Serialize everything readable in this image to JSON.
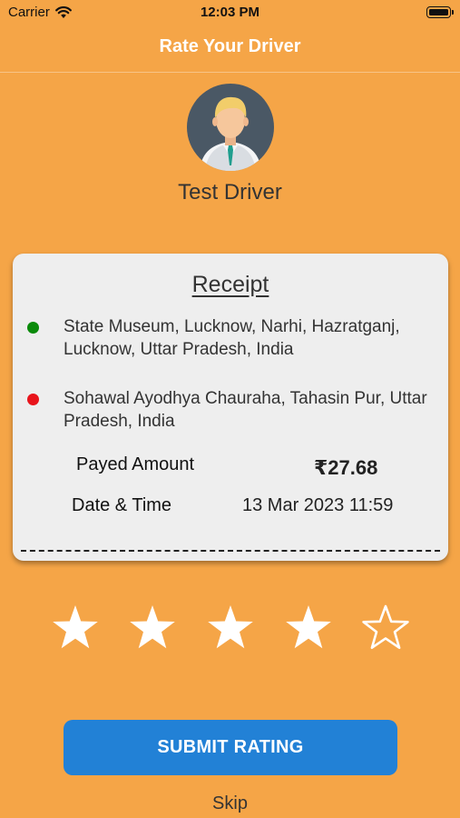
{
  "status_bar": {
    "carrier": "Carrier",
    "time": "12:03 PM",
    "wifi_icon": "wifi-icon",
    "battery_icon": "battery-full-icon"
  },
  "nav": {
    "title": "Rate Your Driver"
  },
  "driver": {
    "avatar_icon": "driver-avatar-icon",
    "name": "Test Driver"
  },
  "receipt": {
    "title": "Receipt",
    "pickup": {
      "address": "State Museum, Lucknow, Narhi, Hazratganj, Lucknow, Uttar Pradesh, India",
      "dot_color": "#0a8a0a"
    },
    "dropoff": {
      "address": "Sohawal Ayodhya Chauraha, Tahasin Pur, Uttar Pradesh, India",
      "dot_color": "#e8141b"
    },
    "amount_label": "Payed Amount",
    "amount_value": "₹27.68",
    "date_label": "Date & Time",
    "date_value": "13 Mar 2023 11:59"
  },
  "rating": {
    "selected": 4,
    "max": 5,
    "star_icon": "star-icon"
  },
  "actions": {
    "submit_label": "SUBMIT RATING",
    "skip_label": "Skip"
  },
  "colors": {
    "background": "#f5a547",
    "button": "#2281d6",
    "card": "#eeeeee"
  }
}
